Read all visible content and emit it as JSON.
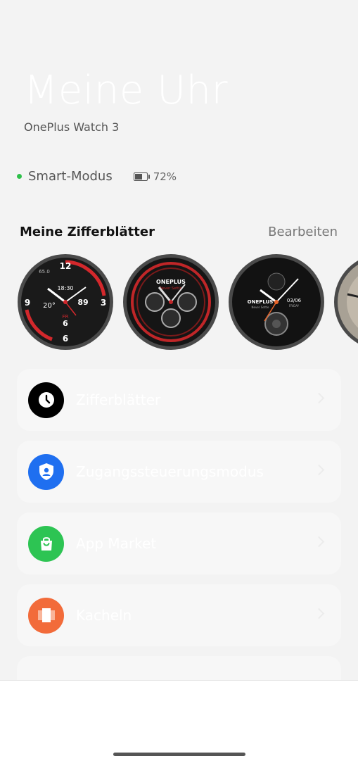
{
  "header": {
    "title": "Meine Uhr",
    "device_name": "OnePlus Watch 3"
  },
  "status": {
    "mode_label": "Smart-Modus",
    "mode_color": "#2ec04a",
    "battery_text": "72%",
    "battery_level": 0.72
  },
  "watchfaces": {
    "section_title": "Meine Zifferblätter",
    "edit_label": "Bearbeiten",
    "faces": [
      {
        "name": "sport-dashboard",
        "time": "18:30",
        "numerals": [
          "12",
          "3",
          "6",
          "9"
        ],
        "temp": "20°",
        "heart": "89",
        "date_day": "FR",
        "date_num": "6",
        "steps": "65.0"
      },
      {
        "name": "oneplus-chronograph",
        "brand": "ONEPLUS",
        "sub_brand": "Never Settle"
      },
      {
        "name": "oneplus-tourbillon",
        "brand": "ONEPLUS",
        "date": "03/06",
        "weekday": "FRIDAY",
        "sub_brand": "Never Settle"
      },
      {
        "name": "classic-gold"
      }
    ]
  },
  "menu": {
    "items": [
      {
        "label": "Zifferblätter",
        "icon": "clock-icon",
        "color": "#000000"
      },
      {
        "label": "Zugangssteuerungsmodus",
        "icon": "shield-user-icon",
        "color": "#1f6ff0"
      },
      {
        "label": "App Market",
        "icon": "shopping-bag-icon",
        "color": "#2dc453"
      },
      {
        "label": "Kacheln",
        "icon": "tiles-icon",
        "color": "#f26b3a"
      }
    ]
  }
}
